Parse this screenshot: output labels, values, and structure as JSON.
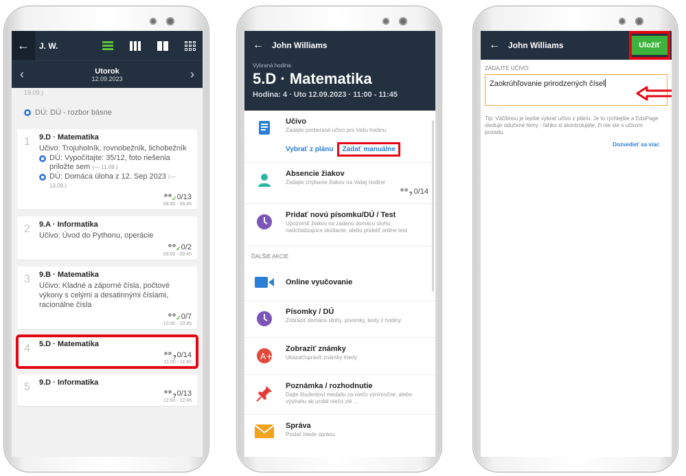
{
  "phone1": {
    "header": {
      "back_icon": "arrow-left-icon",
      "user": "J. W."
    },
    "day": {
      "name": "Utorok",
      "date": "12.09.2023"
    },
    "truncated_text": "19.09.)",
    "du_item": "DÚ: DÚ - rozbor básne",
    "lessons": [
      {
        "num": "1",
        "title": "9.D · Matematika",
        "lines": [
          "Učivo: Trojuholník, rovnobežník, lichobežník"
        ],
        "dus": [
          {
            "text": "DÚ: Vypočítajte: 35/12, foto riešenia priložte sem",
            "arrow": "(— 11.09.)"
          },
          {
            "text": "DÚ: Domáca úloha z 12. Sep 2023",
            "arrow": "(— 13.09.)"
          }
        ],
        "count": "0/13",
        "time": "08:00 - 08:45"
      },
      {
        "num": "2",
        "title": "9.A · Informatika",
        "lines": [
          "Učivo: Úvod do Pythonu, operácie"
        ],
        "dus": [],
        "count": "0/2",
        "time": "09:00 - 09:45"
      },
      {
        "num": "3",
        "title": "9.B · Matematika",
        "lines": [
          "Učivo: Kladné a záporné čísla, počtové výkony s celými a desatinnými číslami, racionálne čísla"
        ],
        "dus": [],
        "count": "0/7",
        "time": "10:00 - 10:45"
      },
      {
        "num": "4",
        "title": "5.D · Matematika",
        "lines": [],
        "dus": [],
        "count": "0/14",
        "time": "11:00 - 11:45"
      },
      {
        "num": "5",
        "title": "9.D · Informatika",
        "lines": [],
        "dus": [],
        "count": "0/13",
        "time": "12:00 - 12:45"
      }
    ]
  },
  "phone2": {
    "header": {
      "user": "John Williams",
      "selected_label": "Vybraná hodina",
      "lesson": "5.D · Matematika",
      "sub": "Hodina: 4 · Uto 12.09.2023 · 11:00 - 11:45"
    },
    "ucivo": {
      "title": "Učivo",
      "desc": "Zadajte preberané učivo pre Vašu hodinu",
      "link_plan": "Vybrať z plánu",
      "link_manual": "Zadať manuálne"
    },
    "absence": {
      "title": "Absencie žiakov",
      "desc": "Zadajte chýbanie žiakov na Vašej hodine",
      "count": "0/14"
    },
    "test": {
      "title": "Pridať novú písomku/DÚ / Test",
      "desc": "Upozorniť žiakov na zadanú domácu úlohu, nadchádzajúce skúšanie, alebo prideliť online test"
    },
    "section": "ĎALŠIE AKCIE",
    "more": [
      {
        "title": "Online vyučovanie",
        "desc": "",
        "icon": "video-camera-icon"
      },
      {
        "title": "Písomky / DÚ",
        "desc": "Zobraziť domáce úlohy, písomky, testy z hodiny",
        "icon": "clock-icon"
      },
      {
        "title": "Zobraziť známky",
        "desc": "Ukázať/upraviť známky triedy",
        "icon": "grade-icon"
      },
      {
        "title": "Poznámka / rozhodnutie",
        "desc": "Dajte študentovi medailu za niečo výnimočné, alebo výstrahu ak urobil niečo zlé ...",
        "icon": "pin-icon"
      },
      {
        "title": "Správa",
        "desc": "Poslať triede správu",
        "icon": "envelope-icon"
      }
    ]
  },
  "phone3": {
    "header": {
      "user": "John Williams",
      "save": "Uložiť"
    },
    "field_label": "ZADAJTE UČIVO:",
    "field_value": "Zaokrúhľovanie prirodzených čísel",
    "tip": "Tip: Väčšinou je lepšie vybrať učivo z plánu. Je to rýchlejšie a EduPage sleduje odučené témy - ľahko si skontrolujete, či nie ste s učivom pozadu.",
    "more_link": "Dozvedieť sa viac"
  },
  "colors": {
    "header": "#23303f",
    "accent_green": "#3db23c",
    "highlight_red": "#e30613",
    "link_blue": "#2b7fd4"
  }
}
